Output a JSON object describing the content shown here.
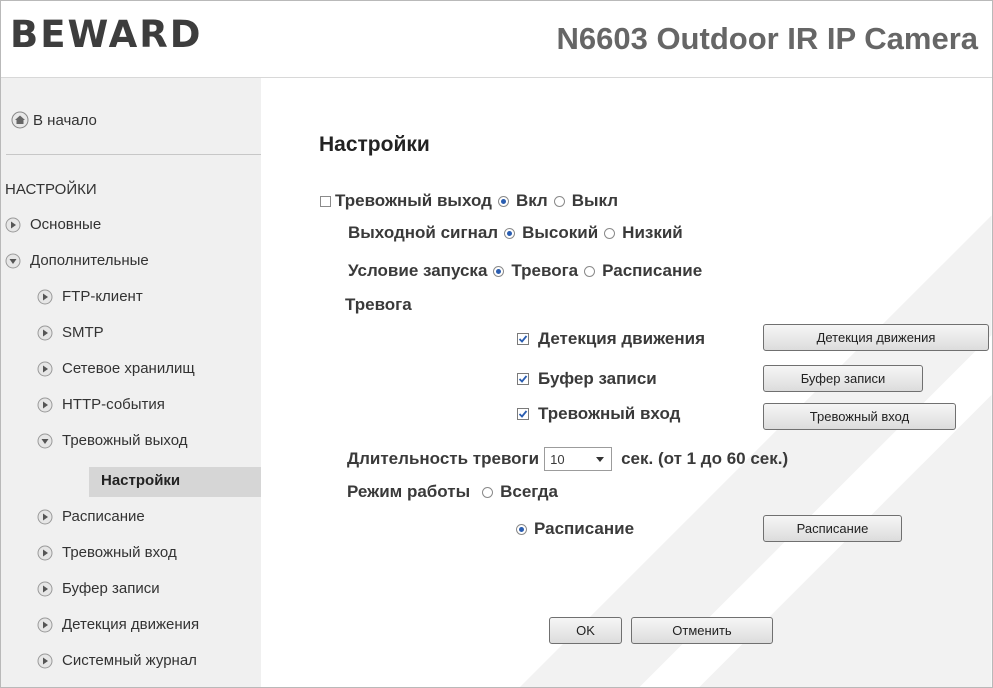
{
  "header": {
    "logo": "BEWARD",
    "model": "N6603 Outdoor IR IP Camera"
  },
  "sidebar": {
    "home_label": "В начало",
    "section_title": "НАСТРОЙКИ",
    "items": [
      {
        "label": "Основные",
        "expanded": false
      },
      {
        "label": "Дополнительные",
        "expanded": true
      },
      {
        "label": "FTP-клиент",
        "expanded": false
      },
      {
        "label": "SMTP",
        "expanded": false
      },
      {
        "label": "Сетевое хранилищ",
        "expanded": false
      },
      {
        "label": "HTTP-события",
        "expanded": false
      },
      {
        "label": "Тревожный выход",
        "expanded": true
      },
      {
        "label": "Настройки",
        "active": true
      },
      {
        "label": "Расписание",
        "expanded": false
      },
      {
        "label": "Тревожный вход",
        "expanded": false
      },
      {
        "label": "Буфер записи",
        "expanded": false
      },
      {
        "label": "Детекция движения",
        "expanded": false
      },
      {
        "label": "Системный журнал",
        "expanded": false
      }
    ]
  },
  "main": {
    "title": "Настройки",
    "alarm_output": {
      "label": "Тревожный выход",
      "on_label": "Вкл",
      "off_label": "Выкл",
      "selected": "on"
    },
    "output_signal": {
      "label": "Выходной сигнал",
      "high_label": "Высокий",
      "low_label": "Низкий",
      "selected": "high"
    },
    "trigger_condition": {
      "label": "Условие запуска",
      "alarm_label": "Тревога",
      "schedule_label": "Расписание",
      "selected": "alarm"
    },
    "alarm_section": {
      "label": "Тревога",
      "items": [
        {
          "label": "Детекция движения",
          "checked": true,
          "button": "Детекция движения"
        },
        {
          "label": "Буфер записи",
          "checked": true,
          "button": "Буфер записи"
        },
        {
          "label": "Тревожный вход",
          "checked": true,
          "button": "Тревожный вход"
        }
      ]
    },
    "duration": {
      "label": "Длительность тревоги",
      "value": "10",
      "suffix": "сек. (от 1 до 60 сек.)"
    },
    "mode": {
      "label": "Режим работы",
      "always_label": "Всегда",
      "schedule_label": "Расписание",
      "schedule_button": "Расписание",
      "selected": "schedule"
    },
    "ok_button": "OK",
    "cancel_button": "Отменить"
  },
  "colors": {
    "accent_radio": "#2a5db0",
    "sidebar_bg": "#f0f0f0",
    "active_item_bg": "#d6d6d6"
  }
}
